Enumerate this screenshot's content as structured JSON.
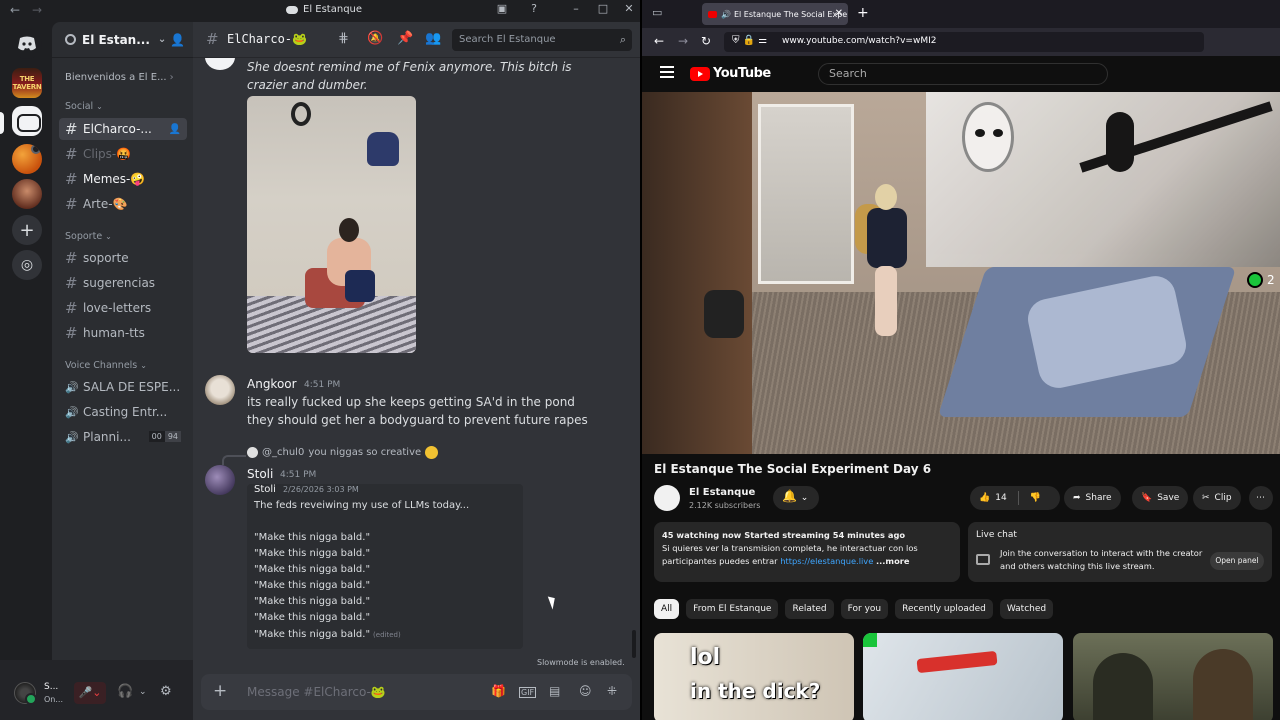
{
  "discord": {
    "window_title": "El Estanque",
    "guilds": {
      "tavern_label": "THE TAVERN"
    },
    "server": {
      "name": "El Estan...",
      "welcome": "Bienvenidos a El E..."
    },
    "categories": {
      "social": "Social",
      "soporte": "Soporte",
      "voice": "Voice Channels"
    },
    "channels": {
      "social": [
        {
          "name": "ElCharco-..."
        },
        {
          "name": "Clips-🤬"
        },
        {
          "name": "Memes-🤪"
        },
        {
          "name": "Arte-🎨"
        }
      ],
      "soporte": [
        {
          "name": "soporte"
        },
        {
          "name": "sugerencias"
        },
        {
          "name": "love-letters"
        },
        {
          "name": "human-tts"
        }
      ],
      "voice": [
        {
          "name": "SALA DE ESPE..."
        },
        {
          "name": "Casting Entr..."
        },
        {
          "name": "Planni...",
          "badge_a": "00",
          "badge_b": "94"
        }
      ]
    },
    "user": {
      "name": "S...",
      "status": "On..."
    },
    "chat": {
      "channel_name": "ElCharco-🐸",
      "search_placeholder": "Search El Estanque",
      "messages": {
        "top_text": "She doesnt remind me of Fenix anymore. This bitch is crazier and dumber.",
        "angkoor": {
          "author": "Angkoor",
          "time": "4:51 PM",
          "text": "its really fucked up she keeps getting SA'd in the pond they should get her a bodyguard to prevent future rapes"
        },
        "stoli": {
          "reply_to": "@_chul0",
          "reply_text": "you niggas so creative",
          "author": "Stoli",
          "time": "4:51 PM",
          "quote": {
            "author": "Stoli",
            "time": "2/26/2026 3:03 PM",
            "lines": [
              "The feds reveiwing my use of LLMs today...",
              "\"Make this nigga bald.\"",
              "\"Make this nigga bald.\"",
              "\"Make this nigga bald.\"",
              "\"Make this nigga bald.\"",
              "\"Make this nigga bald.\"",
              "\"Make this nigga bald.\"",
              "\"Make this nigga bald.\""
            ],
            "edited": "(edited)"
          }
        }
      },
      "slowmode": "Slowmode is enabled.",
      "composer_placeholder": "Message #ElCharco-🐸"
    }
  },
  "browser": {
    "tab_title": "El Estanque The Social Expe",
    "url": "www.youtube.com/watch?v=wMI2",
    "youtube": {
      "logo": "YouTube",
      "search_placeholder": "Search",
      "overlay_count": "2",
      "video_title": "El Estanque The Social Experiment Day 6",
      "channel_name": "El Estanque",
      "subscribers": "2.12K subscribers",
      "likes": "14",
      "share": "Share",
      "save": "Save",
      "clip": "Clip",
      "description": {
        "stats": "45 watching now  Started streaming 54 minutes ago",
        "text": "Si quieres ver la transmision completa, he interactuar con los participantes puedes entrar",
        "link": "https://elestanque.live",
        "more": "...more"
      },
      "live_chat": {
        "title": "Live chat",
        "text": "Join the conversation to interact with the creator and others watching this live stream.",
        "button": "Open panel"
      },
      "chips": [
        "All",
        "From El Estanque",
        "Related",
        "For you",
        "Recently uploaded",
        "Watched"
      ],
      "thumb1_line1": "lol",
      "thumb1_line2": "in the dick?"
    }
  }
}
